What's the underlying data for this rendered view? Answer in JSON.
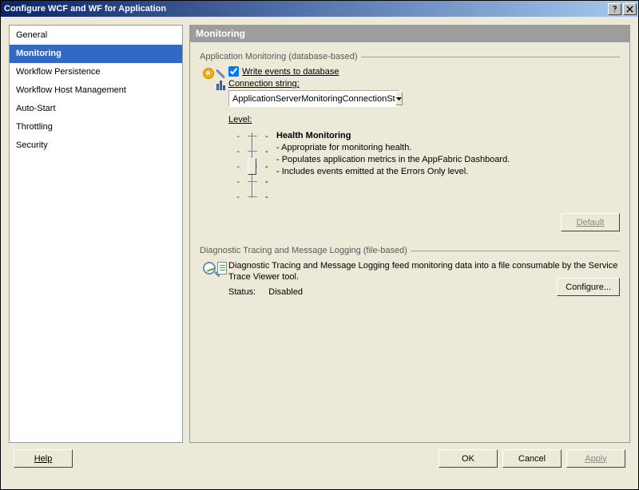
{
  "title": "Configure WCF and WF for Application",
  "sidebar": {
    "items": [
      {
        "label": "General"
      },
      {
        "label": "Monitoring",
        "selected": true
      },
      {
        "label": "Workflow Persistence"
      },
      {
        "label": "Workflow Host Management"
      },
      {
        "label": "Auto-Start"
      },
      {
        "label": "Throttling"
      },
      {
        "label": "Security"
      }
    ]
  },
  "content": {
    "heading": "Monitoring",
    "app_monitoring": {
      "group_label": "Application Monitoring (database-based)",
      "write_events_label": "Write events to database",
      "write_events_checked": true,
      "conn_label": "Connection string:",
      "conn_value": "ApplicationServerMonitoringConnectionSt",
      "level_label": "Level:",
      "slider_ticks": [
        "-",
        "-",
        "-",
        "-",
        "-"
      ],
      "level_title": "Health Monitoring",
      "level_lines": [
        "- Appropriate for monitoring health.",
        "- Populates application metrics in the AppFabric Dashboard.",
        "- Includes events emitted at the Errors Only level."
      ],
      "default_button": "Default"
    },
    "diag": {
      "group_label": "Diagnostic Tracing and Message Logging (file-based)",
      "description": "Diagnostic Tracing and Message Logging feed monitoring data into a file consumable by the Service Trace Viewer tool.",
      "status_label": "Status:",
      "status_value": "Disabled",
      "configure_button": "Configure..."
    }
  },
  "buttons": {
    "help": "Help",
    "ok": "OK",
    "cancel": "Cancel",
    "apply": "Apply"
  }
}
